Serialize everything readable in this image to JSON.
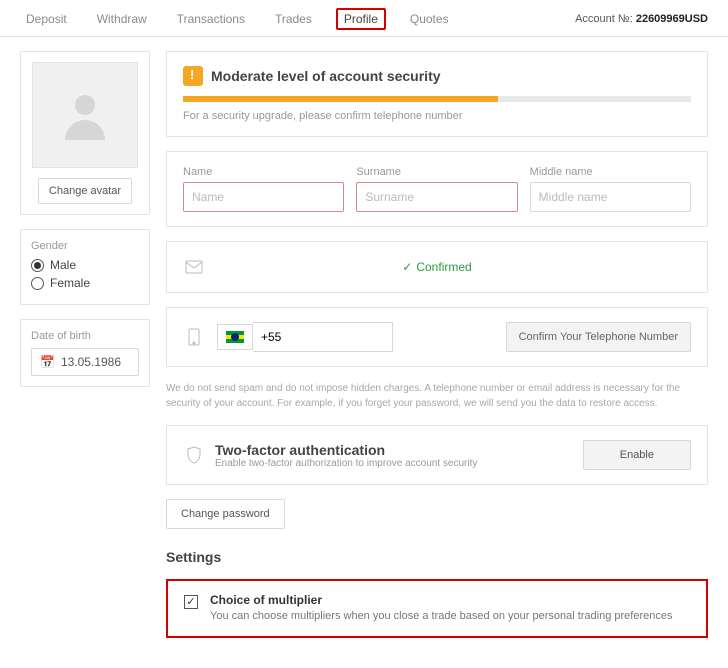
{
  "account_label": "Account №:",
  "account_number": "22609969USD",
  "tabs": {
    "deposit": "Deposit",
    "withdraw": "Withdraw",
    "transactions": "Transactions",
    "trades": "Trades",
    "profile": "Profile",
    "quotes": "Quotes"
  },
  "sidebar": {
    "change_avatar": "Change avatar",
    "gender_label": "Gender",
    "gender_male": "Male",
    "gender_female": "Female",
    "dob_label": "Date of birth",
    "dob_value": "13.05.1986"
  },
  "security": {
    "title": "Moderate level of account security",
    "note": "For a security upgrade, please confirm telephone number",
    "progress_percent": 62
  },
  "name_form": {
    "name_label": "Name",
    "name_placeholder": "Name",
    "surname_label": "Surname",
    "surname_placeholder": "Surname",
    "middle_label": "Middle name",
    "middle_placeholder": "Middle name"
  },
  "email": {
    "confirmed": "Confirmed"
  },
  "phone": {
    "dial_code": "+55",
    "confirm_btn": "Confirm Your Telephone Number"
  },
  "spam_note": "We do not send spam and do not impose hidden charges. A telephone number or email address is necessary for the security of your account. For example, if you forget your password, we will send you the data to restore access.",
  "twofa": {
    "title": "Two-factor authentication",
    "sub": "Enable two-factor authorization to improve account security",
    "enable_btn": "Enable"
  },
  "change_password_btn": "Change password",
  "settings_heading": "Settings",
  "multiplier": {
    "title": "Choice of multiplier",
    "sub": "You can choose multipliers when you close a trade based on your personal trading preferences"
  }
}
